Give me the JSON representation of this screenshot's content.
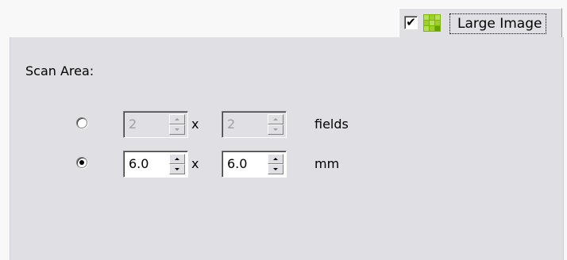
{
  "tab": {
    "checked": true,
    "checkmark": "✔",
    "label": "Large Image",
    "icon": "large-image-grid-icon"
  },
  "scan_area": {
    "label": "Scan Area:",
    "options": [
      {
        "selected": false,
        "enabled": false,
        "width_value": "2",
        "height_value": "2",
        "separator": "x",
        "unit": "fields"
      },
      {
        "selected": true,
        "enabled": true,
        "width_value": "6.0",
        "height_value": "6.0",
        "separator": "x",
        "unit": "mm"
      }
    ]
  },
  "colors": {
    "panel_bg": "#e0dfe3",
    "icon_green": "#7ab800",
    "icon_green_light": "#b5e05a"
  }
}
